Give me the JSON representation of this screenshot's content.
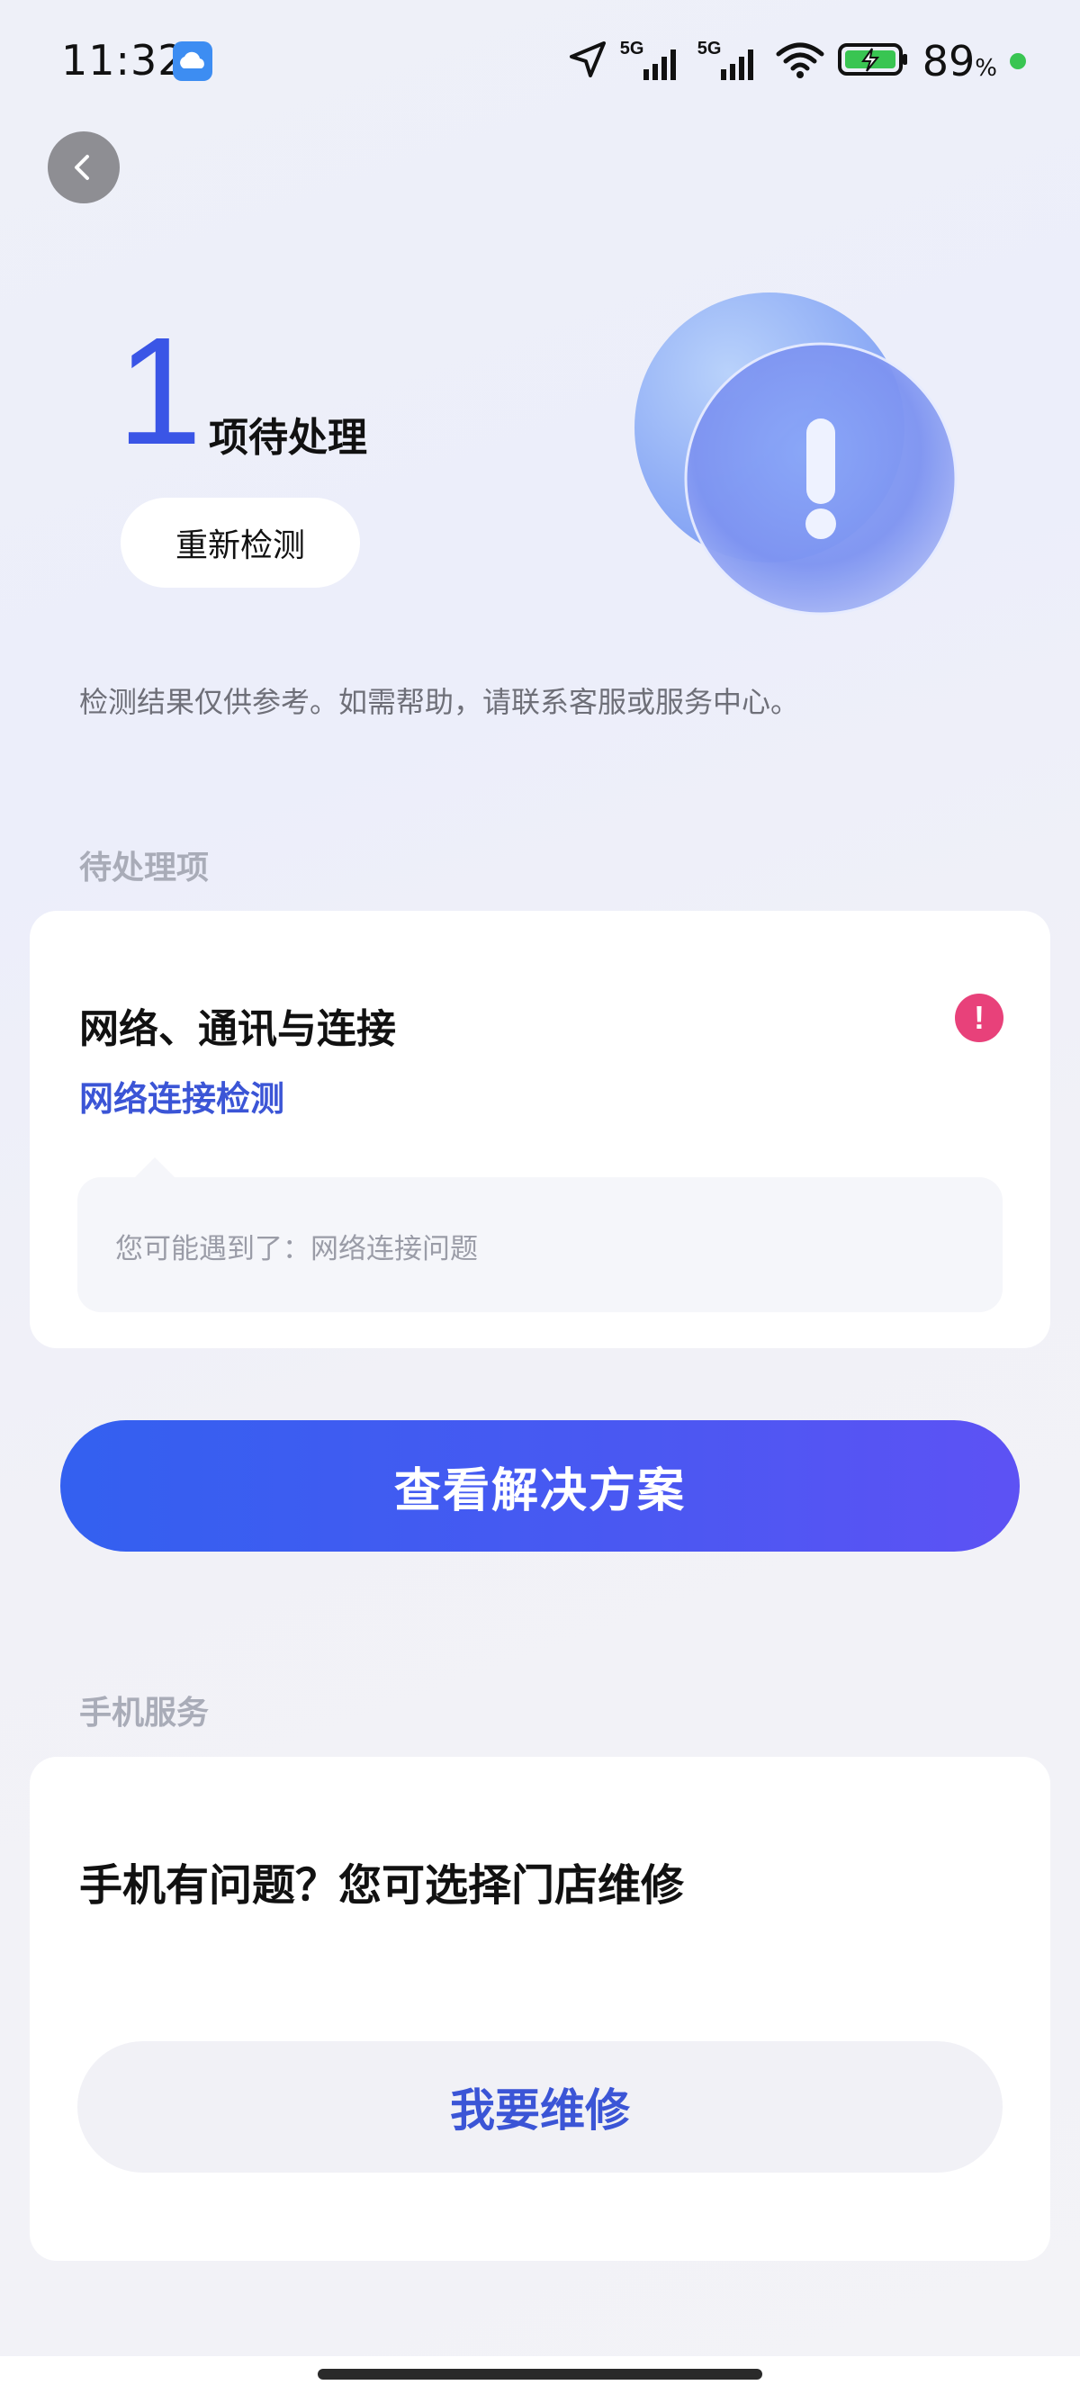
{
  "status_bar": {
    "time": "11:32",
    "network1": "5G",
    "network2": "5G",
    "battery_percent": "89",
    "battery_unit": "%"
  },
  "header": {
    "pending_count": "1",
    "pending_label": "项待处理",
    "recheck_label": "重新检测",
    "disclaimer": "检测结果仅供参考。如需帮助，请联系客服或服务中心。"
  },
  "pending_section": {
    "title": "待处理项",
    "item": {
      "category": "网络、通讯与连接",
      "check_name": "网络连接检测",
      "hint": "您可能遇到了：网络连接问题",
      "alert_glyph": "!"
    },
    "solution_label": "查看解决方案"
  },
  "service_section": {
    "title": "手机服务",
    "question": "手机有问题？您可选择门店维修",
    "repair_label": "我要维修"
  },
  "colors": {
    "accent": "#3a55e6",
    "link": "#3b55d6",
    "alert": "#e8417a",
    "battery_ok": "#39c552"
  }
}
